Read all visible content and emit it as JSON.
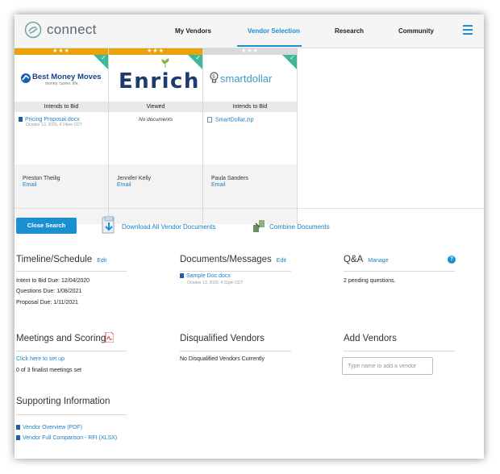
{
  "app": {
    "logo_text": "connect"
  },
  "nav": {
    "items": [
      {
        "label": "My Vendors"
      },
      {
        "label": "Vendor Selection"
      },
      {
        "label": "Research"
      },
      {
        "label": "Community"
      }
    ]
  },
  "vendors": [
    {
      "logo_text": "Best Money Moves",
      "logo_tagline": "money. career. life.",
      "rating": "★★★",
      "status": "Intends to Bid",
      "document": {
        "name": "Pricing Proposal.docx",
        "date": "October 13, 2020, 4:14pm CDT"
      },
      "contact": {
        "name": "Preston Theilig",
        "email_label": "Email"
      }
    },
    {
      "logo_text": "Enrich",
      "rating": "★★★",
      "status": "Viewed",
      "no_docs": "No documents",
      "contact": {
        "name": "Jennifer Kelly",
        "email_label": "Email"
      }
    },
    {
      "logo_text": "smartdollar",
      "rating": "★★★",
      "status": "Intends to Bid",
      "document": {
        "name": "SmartDollar.zip"
      },
      "contact": {
        "name": "Paula Sanders",
        "email_label": "Email"
      }
    }
  ],
  "actions": {
    "close_search": "Close Search",
    "download_all": "Download All Vendor Documents",
    "combine": "Combine Documents"
  },
  "timeline": {
    "title": "Timeline/Schedule",
    "edit": "Edit",
    "lines": [
      "Intent to Bid Due: 12/04/2020",
      "Questions Due: 1/08/2021",
      "Proposal Due: 1/11/2021"
    ]
  },
  "documents": {
    "title": "Documents/Messages",
    "edit": "Edit",
    "item": {
      "name": "Sample Doc.docx",
      "date": "October 13, 2020, 4:11pm CDT"
    }
  },
  "qa": {
    "title": "Q&A",
    "manage": "Manage",
    "help": "?",
    "text": "2 pending questions."
  },
  "meetings": {
    "title": "Meetings and Scoring",
    "link": "Click here to set up",
    "text": "0 of 3 finalist meetings set"
  },
  "disqualified": {
    "title": "Disqualified Vendors",
    "text": "No Disqualified Vendors Currently"
  },
  "add_vendors": {
    "title": "Add Vendors",
    "placeholder": "Type name to add a vendor"
  },
  "supporting": {
    "title": "Supporting Information",
    "links": [
      "Vendor Overview (PDF)",
      "Vendor Full Comparison - RFI (XLSX)"
    ]
  },
  "colors": {
    "accent": "#1a8fd1",
    "rating_bar": "#e8a30c",
    "check": "#3fb79b"
  }
}
